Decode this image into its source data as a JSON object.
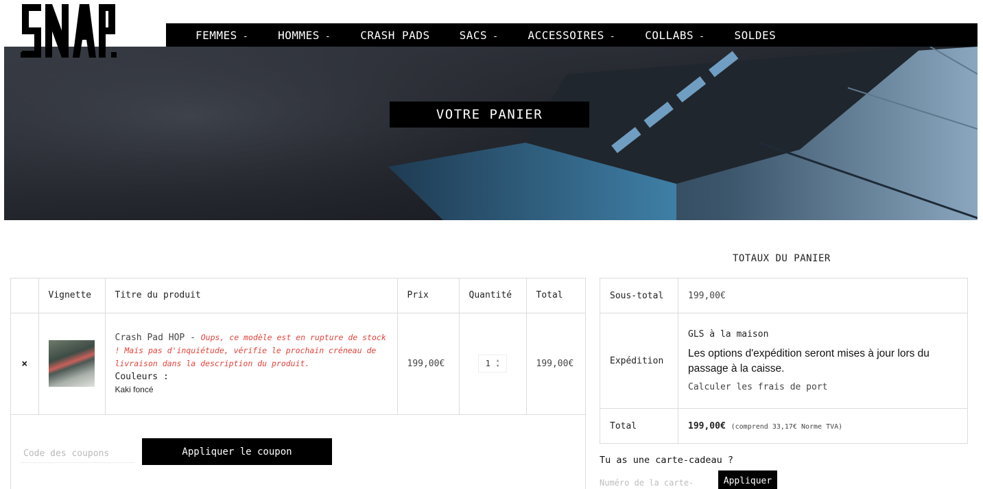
{
  "brand": {
    "logo_text": "SNAP"
  },
  "nav": {
    "items": [
      {
        "label": "FEMMES",
        "has_dropdown": true
      },
      {
        "label": "HOMMES",
        "has_dropdown": true
      },
      {
        "label": "CRASH PADS",
        "has_dropdown": false
      },
      {
        "label": "SACS",
        "has_dropdown": true
      },
      {
        "label": "ACCESSOIRES",
        "has_dropdown": true
      },
      {
        "label": "COLLABS",
        "has_dropdown": true
      },
      {
        "label": "SOLDES",
        "has_dropdown": false
      }
    ],
    "caret": "-"
  },
  "hero": {
    "title": "VOTRE PANIER"
  },
  "cart": {
    "headers": {
      "remove": "",
      "thumb": "Vignette",
      "title": "Titre du produit",
      "price": "Prix",
      "qty": "Quantité",
      "total": "Total"
    },
    "items": [
      {
        "remove": "×",
        "name": "Crash Pad HOP",
        "separator": " - ",
        "stock_message": "Oups, ce modèle est en rupture de stock ! Mais pas d'inquiétude, vérifie le prochain créneau de livraison dans la description du produit.",
        "attr_label": "Couleurs :",
        "attr_value": "Kaki foncé",
        "price": "199,00€",
        "quantity": "1",
        "total": "199,00€"
      }
    ],
    "coupon": {
      "placeholder": "Code des coupons",
      "button": "Appliquer le coupon"
    }
  },
  "totals": {
    "heading": "TOTAUX DU PANIER",
    "subtotal_label": "Sous-total",
    "subtotal_value": "199,00€",
    "shipping_label": "Expédition",
    "shipping_method": "GLS à la maison",
    "shipping_info": "Les options d'expédition seront mises à jour lors du passage à la caisse.",
    "shipping_calc": "Calculer les frais de port",
    "total_label": "Total",
    "total_value": "199,00€",
    "total_tax": "(comprend 33,17€ Norme TVA)"
  },
  "giftcard": {
    "question": "Tu as une carte-cadeau ?",
    "placeholder": "Numéro de la carte-",
    "button": "Appliquer"
  },
  "colors": {
    "accent": "#000000",
    "warning": "#e1433a",
    "border": "#dcdcdc"
  }
}
